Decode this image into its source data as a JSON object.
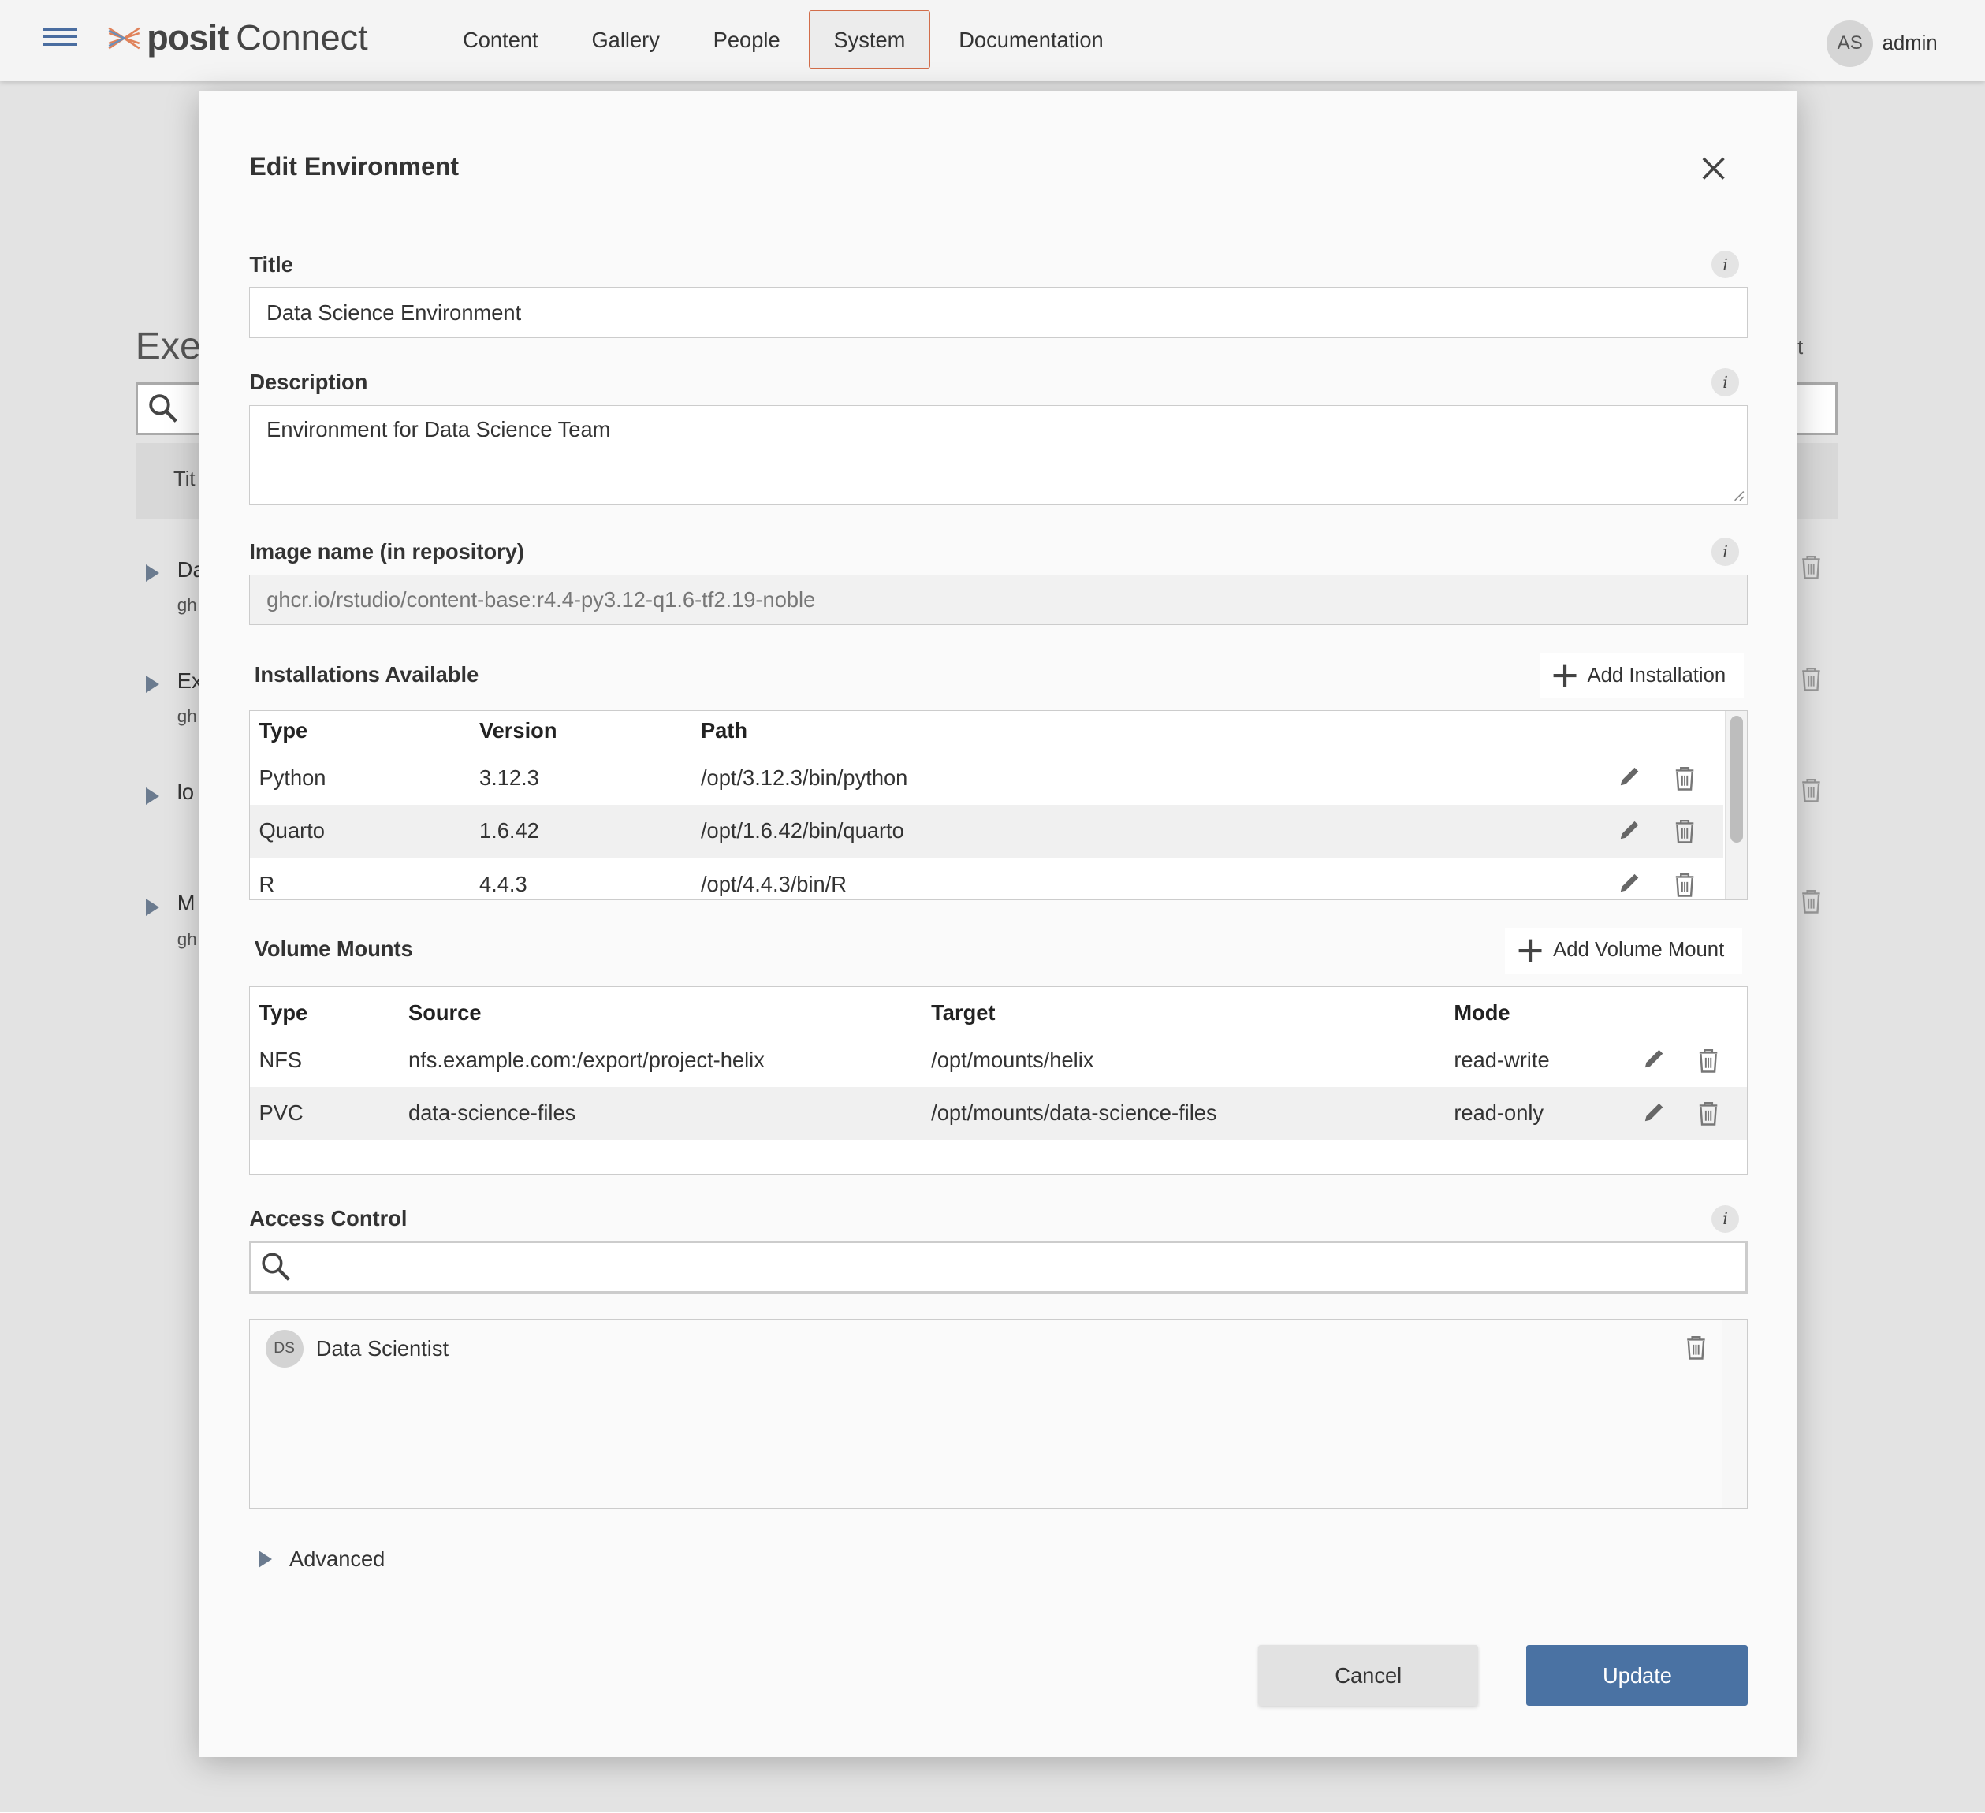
{
  "app": {
    "brand": "posit",
    "product": "Connect",
    "nav": [
      "Content",
      "Gallery",
      "People",
      "System",
      "Documentation"
    ],
    "active_nav": "System",
    "user": {
      "initials": "AS",
      "name": "admin"
    }
  },
  "background": {
    "title_fragment": "Exe",
    "right_fragment": "t",
    "header_fragment": "Tit",
    "rows": [
      {
        "t1": "Da",
        "t2": "gh"
      },
      {
        "t1": "Ex",
        "t2": "gh"
      },
      {
        "t1": "lo",
        "t2": ""
      },
      {
        "t1": "M",
        "t2": "gh"
      }
    ]
  },
  "modal": {
    "title": "Edit Environment",
    "title_field": {
      "label": "Title",
      "value": "Data Science Environment"
    },
    "description_field": {
      "label": "Description",
      "value": "Environment for Data Science Team"
    },
    "image_field": {
      "label": "Image name (in repository)",
      "value": "ghcr.io/rstudio/content-base:r4.4-py3.12-q1.6-tf2.19-noble"
    },
    "installations": {
      "title": "Installations Available",
      "add_label": "Add Installation",
      "headers": [
        "Type",
        "Version",
        "Path"
      ],
      "rows": [
        {
          "type": "Python",
          "version": "3.12.3",
          "path": "/opt/3.12.3/bin/python"
        },
        {
          "type": "Quarto",
          "version": "1.6.42",
          "path": "/opt/1.6.42/bin/quarto"
        },
        {
          "type": "R",
          "version": "4.4.3",
          "path": "/opt/4.4.3/bin/R"
        }
      ]
    },
    "volumes": {
      "title": "Volume Mounts",
      "add_label": "Add Volume Mount",
      "headers": [
        "Type",
        "Source",
        "Target",
        "Mode"
      ],
      "rows": [
        {
          "type": "NFS",
          "source": "nfs.example.com:/export/project-helix",
          "target": "/opt/mounts/helix",
          "mode": "read-write"
        },
        {
          "type": "PVC",
          "source": "data-science-files",
          "target": "/opt/mounts/data-science-files",
          "mode": "read-only"
        }
      ]
    },
    "access": {
      "label": "Access Control",
      "search_value": "",
      "principals": [
        {
          "initials": "DS",
          "name": "Data Scientist"
        }
      ]
    },
    "advanced_label": "Advanced",
    "cancel_label": "Cancel",
    "update_label": "Update"
  },
  "colors": {
    "accent": "#4a72a3",
    "active_nav_border": "#d26d4a"
  }
}
